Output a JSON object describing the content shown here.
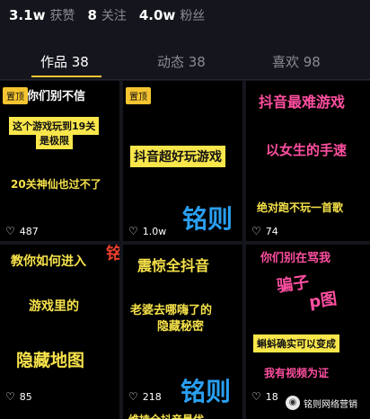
{
  "stats": [
    {
      "value": "3.1w",
      "label": "获赞"
    },
    {
      "value": "8",
      "label": "关注"
    },
    {
      "value": "4.0w",
      "label": "粉丝"
    }
  ],
  "tabs": [
    {
      "label": "作品 38"
    },
    {
      "label": "动态 38"
    },
    {
      "label": "喜欢 98"
    }
  ],
  "pinned_label": "置顶",
  "videos": [
    {
      "lines": [
        "你们别不信",
        "这个游戏玩到19关",
        "是极限",
        "20关神仙也过不了"
      ],
      "likes": "487"
    },
    {
      "lines": [
        "抖音超好玩游戏"
      ],
      "likes": "1.0w"
    },
    {
      "lines": [
        "抖音最难游戏",
        "以女生的手速",
        "绝对跑不玩一首歌"
      ],
      "likes": "74"
    },
    {
      "lines": [
        "教你如何进入",
        "游戏里的",
        "隐藏地图"
      ],
      "likes": "85"
    },
    {
      "lines": [
        "震惊全抖音",
        "老婆去哪嗨了的",
        "隐藏秘密",
        "维持全抖音最优"
      ],
      "likes": "218"
    },
    {
      "lines": [
        "你们别在骂我",
        "骗子",
        "p图",
        "蝌蚪确实可以变成",
        "我有视频为证"
      ],
      "likes": "18"
    }
  ],
  "watermark": "铭则",
  "footer": {
    "brand": "铭则网络营销"
  },
  "colors": {
    "accent": "#f5c430",
    "watermark": "#2a9ff0",
    "background": "#15161d"
  }
}
